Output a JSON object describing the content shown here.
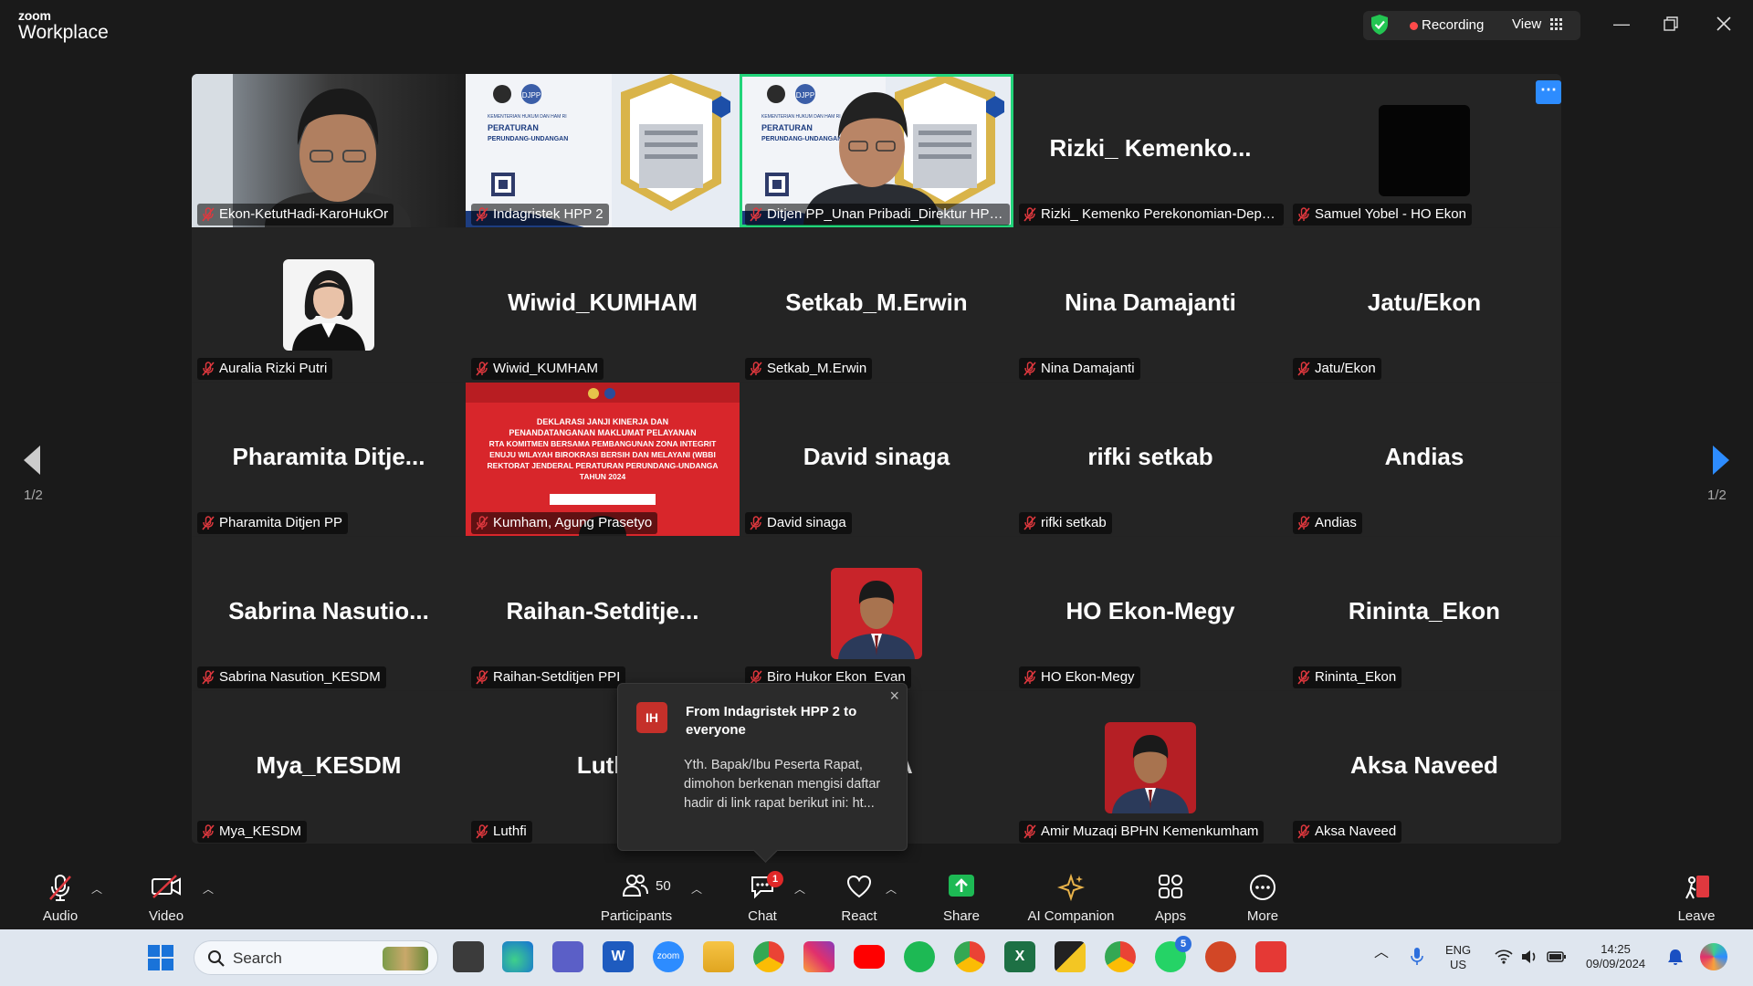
{
  "app": {
    "brand_top": "zoom",
    "brand_bottom": "Workplace"
  },
  "header": {
    "recording_label": "Recording",
    "view_label": "View"
  },
  "pagination": {
    "left": "1/2",
    "right": "1/2"
  },
  "tiles": [
    {
      "bigname": "",
      "label": "Ekon-KetutHadi-KaroHukOr",
      "kind": "video-person"
    },
    {
      "bigname": "",
      "label": "Indagristek HPP 2",
      "kind": "video-banner"
    },
    {
      "bigname": "",
      "label": "Ditjen PP_Unan Pribadi_Direktur HPP II",
      "kind": "video-banner-person"
    },
    {
      "bigname": "Rizki_ Kemenko...",
      "label": "Rizki_ Kemenko Perekonomian-Depu...",
      "kind": "name"
    },
    {
      "bigname": "",
      "label": "Samuel Yobel - HO Ekon",
      "kind": "black-avatar"
    },
    {
      "bigname": "",
      "label": "Auralia Rizki Putri",
      "kind": "photo-woman"
    },
    {
      "bigname": "Wiwid_KUMHAM",
      "label": "Wiwid_KUMHAM",
      "kind": "name"
    },
    {
      "bigname": "Setkab_M.Erwin",
      "label": "Setkab_M.Erwin",
      "kind": "name"
    },
    {
      "bigname": "Nina Damajanti",
      "label": "Nina Damajanti",
      "kind": "name"
    },
    {
      "bigname": "Jatu/Ekon",
      "label": "Jatu/Ekon",
      "kind": "name"
    },
    {
      "bigname": "Pharamita Ditje...",
      "label": "Pharamita Ditjen PP",
      "kind": "name"
    },
    {
      "bigname": "",
      "label": "Kumham, Agung Prasetyo",
      "kind": "video-red"
    },
    {
      "bigname": "David sinaga",
      "label": "David sinaga",
      "kind": "name"
    },
    {
      "bigname": "rifki setkab",
      "label": "rifki setkab",
      "kind": "name"
    },
    {
      "bigname": "Andias",
      "label": "Andias",
      "kind": "name"
    },
    {
      "bigname": "Sabrina Nasutio...",
      "label": "Sabrina Nasution_KESDM",
      "kind": "name"
    },
    {
      "bigname": "Raihan-Setditje...",
      "label": "Raihan-Setditjen PPI",
      "kind": "name"
    },
    {
      "bigname": "",
      "label": "Biro Hukor Ekon_Evan",
      "kind": "photo-man-red"
    },
    {
      "bigname": "HO Ekon-Megy",
      "label": "HO Ekon-Megy",
      "kind": "name"
    },
    {
      "bigname": "Rininta_Ekon",
      "label": "Rininta_Ekon",
      "kind": "name"
    },
    {
      "bigname": "Mya_KESDM",
      "label": "Mya_KESDM",
      "kind": "name"
    },
    {
      "bigname": "Luth",
      "label": "Luthfi",
      "kind": "name"
    },
    {
      "bigname": "GELIA",
      "label": "",
      "kind": "name"
    },
    {
      "bigname": "",
      "label": "Amir Muzaqi BPHN Kemenkumham",
      "kind": "photo-man-red2"
    },
    {
      "bigname": "Aksa Naveed",
      "label": "Aksa Naveed",
      "kind": "name"
    }
  ],
  "banner": {
    "line1": "KEMENTERIAN HUKUM DAN HAM RI",
    "line2": "PERATURAN",
    "line3": "PERUNDANG-UNDANGAN",
    "djpp": "DJPP"
  },
  "red_slide": {
    "l1": "DEKLARASI JANJI KINERJA DAN",
    "l2": "PENANDATANGANAN MAKLUMAT PELAYANAN",
    "l3": "RTA KOMITMEN BERSAMA PEMBANGUNAN ZONA INTEGRIT",
    "l4": "ENUJU WILAYAH BIROKRASI BERSIH DAN MELAYANI (WBBI",
    "l5": "REKTORAT JENDERAL PERATURAN PERUNDANG-UNDANGA",
    "l6": "TAHUN 2024"
  },
  "chat": {
    "initials": "IH",
    "title": "From Indagristek HPP 2 to everyone",
    "body": "Yth. Bapak/Ibu Peserta Rapat, dimohon berkenan mengisi daftar hadir di link rapat berikut ini: ht..."
  },
  "toolbar": {
    "audio": "Audio",
    "video": "Video",
    "participants": "Participants",
    "participants_count": "50",
    "chat": "Chat",
    "chat_badge": "1",
    "react": "React",
    "share": "Share",
    "ai": "AI Companion",
    "apps": "Apps",
    "more": "More",
    "leave": "Leave"
  },
  "taskbar": {
    "search_placeholder": "Search",
    "whatsapp_badge": "5",
    "lang1": "ENG",
    "lang2": "US",
    "time": "14:25",
    "date": "09/09/2024"
  },
  "colors": {
    "accent_green": "#22d47a",
    "zoom_blue": "#2d8cff",
    "mute_red": "#e0383e",
    "share_green": "#1db954"
  }
}
